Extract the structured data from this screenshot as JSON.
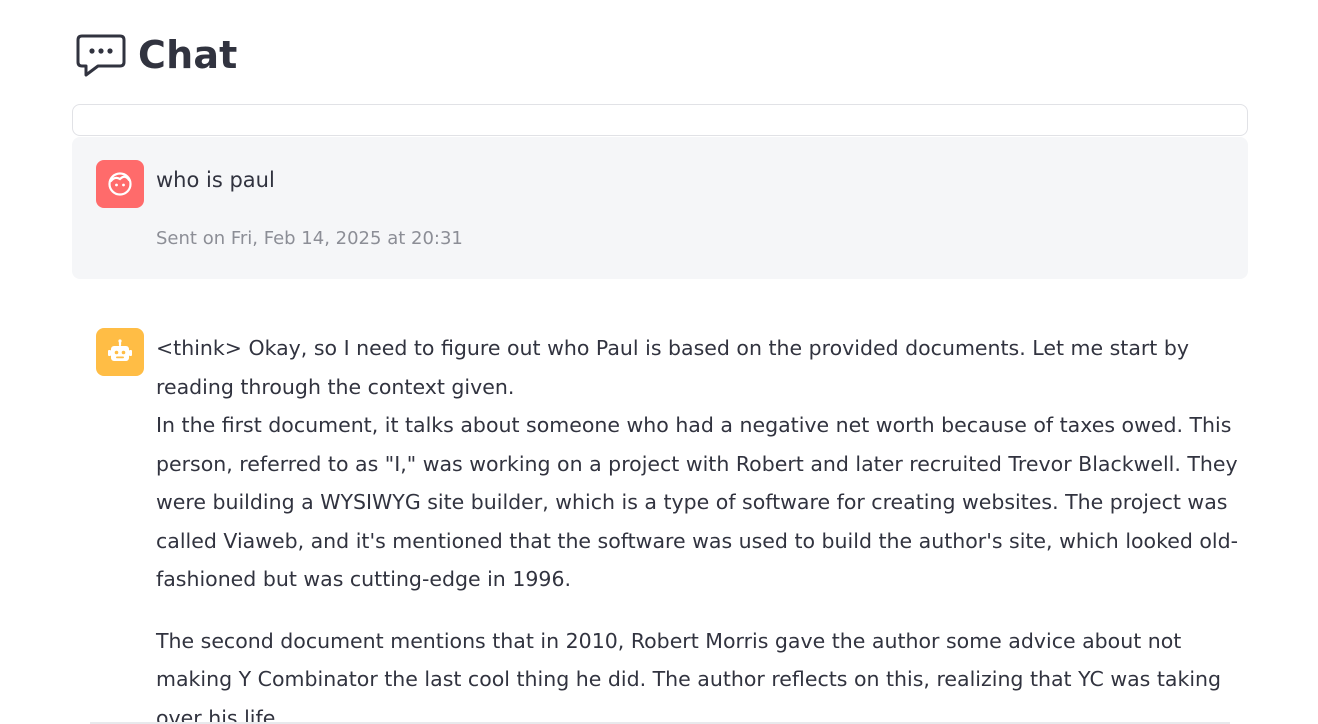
{
  "header": {
    "title": "Chat",
    "icon": "chat-bubble-icon"
  },
  "messages": {
    "user": {
      "avatar_icon": "user-face-icon",
      "text": "who is paul",
      "timestamp": "Sent on Fri, Feb 14, 2025 at 20:31"
    },
    "assistant": {
      "avatar_icon": "robot-icon",
      "para1": "<think> Okay, so I need to figure out who Paul is based on the provided documents. Let me start by reading through the context given.",
      "para1b": "In the first document, it talks about someone who had a negative net worth because of taxes owed. This person, referred to as \"I,\" was working on a project with Robert and later recruited Trevor Blackwell. They were building a WYSIWYG site builder, which is a type of software for creating websites. The project was called Viaweb, and it's mentioned that the software was used to build the author's site, which looked old-fashioned but was cutting-edge in 1996.",
      "para2": "The second document mentions that in 2010, Robert Morris gave the author some advice about not making Y Combinator the last cool thing he did. The author reflects on this, realizing that YC was taking over his life,"
    }
  },
  "colors": {
    "user_avatar": "#ff6b6b",
    "bot_avatar": "#ffbd45",
    "user_bg": "#f5f6f8",
    "text": "#31333f",
    "muted": "#8c8e96"
  }
}
